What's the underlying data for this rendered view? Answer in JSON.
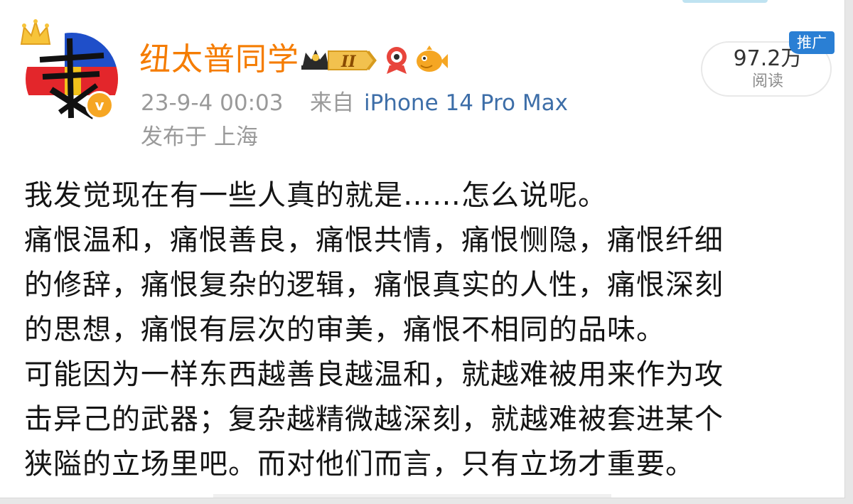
{
  "user": {
    "name": "纽太普同学",
    "verified_mark": "v",
    "member_level": "II"
  },
  "meta": {
    "time": "23-9-4 00:03",
    "source_label": "来自",
    "device": "iPhone 14 Pro Max",
    "location": "发布于 上海"
  },
  "stats": {
    "read_count": "97.2万",
    "read_label": "阅读",
    "promo_label": "推广"
  },
  "post": {
    "lines": [
      "我发觉现在有一些人真的就是……怎么说呢。",
      "痛恨温和，痛恨善良，痛恨共情，痛恨恻隐，痛恨纤细",
      "的修辞，痛恨复杂的逻辑，痛恨真实的人性，痛恨深刻",
      "的思想，痛恨有层次的审美，痛恨不相同的品味。",
      "可能因为一样东西越善良越温和，就越难被用来作为攻",
      "击异己的武器；复杂越精微越深刻，就越难被套进某个",
      "狭隘的立场里吧。而对他们而言，只有立场才重要。"
    ]
  },
  "colors": {
    "name": "#f57c00",
    "link": "#3d6ea8",
    "meta": "#9a9a9a",
    "promo": "#2a7fd4",
    "verified": "#f6a623"
  },
  "icons": {
    "crown": "crown-icon",
    "verified": "verified-badge-icon",
    "member": "member-level-badge-icon",
    "medal_a": "medal-icon",
    "medal_b": "fish-medal-icon"
  }
}
